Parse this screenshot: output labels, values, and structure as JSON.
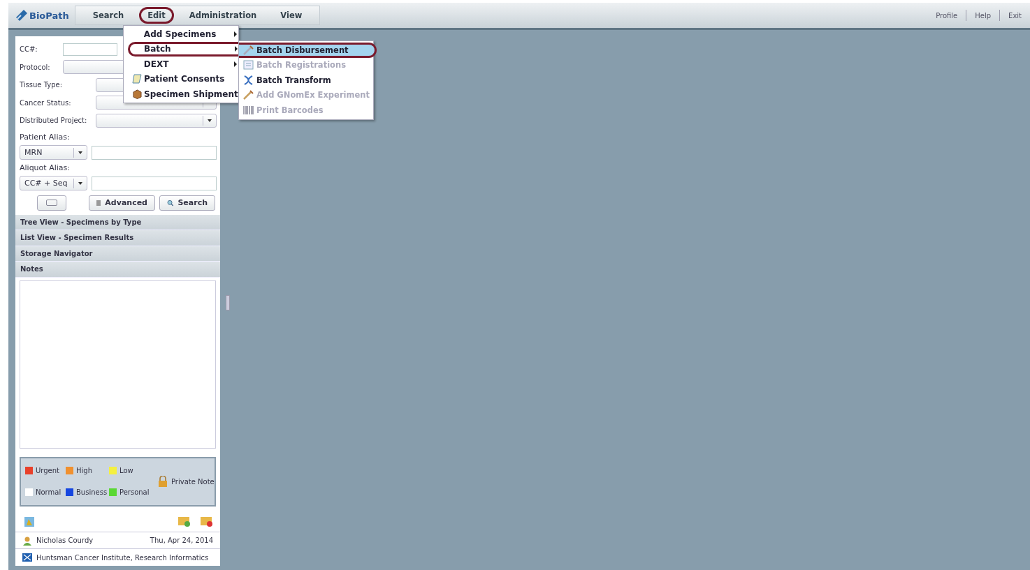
{
  "app": {
    "logo": "BioPath"
  },
  "menubar": [
    {
      "label": "Search",
      "circled": false
    },
    {
      "label": "Edit",
      "circled": true
    },
    {
      "label": "Administration",
      "circled": false
    },
    {
      "label": "View",
      "circled": false
    }
  ],
  "top_links": [
    "Profile",
    "Help",
    "Exit"
  ],
  "edit_menu": [
    {
      "label": "Add Specimens",
      "submenu": true,
      "circled": false
    },
    {
      "label": "Batch",
      "submenu": true,
      "circled": true
    },
    {
      "label": "DEXT",
      "submenu": true,
      "circled": false
    },
    {
      "label": "Patient Consents",
      "submenu": false,
      "circled": false
    },
    {
      "label": "Specimen Shipment",
      "submenu": false,
      "circled": false
    }
  ],
  "batch_menu": [
    {
      "label": "Batch Disbursement",
      "disabled": false,
      "selected": true
    },
    {
      "label": "Batch Registrations",
      "disabled": true,
      "selected": false
    },
    {
      "label": "Batch Transform",
      "disabled": false,
      "selected": false
    },
    {
      "label": "Add GNomEx Experiment",
      "disabled": true,
      "selected": false
    },
    {
      "label": "Print Barcodes",
      "disabled": true,
      "selected": false
    }
  ],
  "form": {
    "cc_label": "CC#:",
    "protocol_label": "Protocol:",
    "tissue_label": "Tissue Type:",
    "cancer_label": "Cancer Status:",
    "project_label": "Distributed Project:",
    "patient_alias_label": "Patient Alias:",
    "patient_alias_type": "MRN",
    "aliquot_alias_label": "Aliquot Alias:",
    "aliquot_alias_type": "CC# + Seq",
    "advanced_button": "Advanced",
    "search_button": "Search"
  },
  "sections": [
    "Tree View - Specimens by Type",
    "List View - Specimen Results",
    "Storage Navigator",
    "Notes"
  ],
  "legend": [
    {
      "label": "Urgent",
      "color": "#e8402a"
    },
    {
      "label": "High",
      "color": "#f0902e"
    },
    {
      "label": "Low",
      "color": "#f4f040"
    },
    {
      "label": "Normal",
      "color": "#ffffff"
    },
    {
      "label": "Business",
      "color": "#1646e0"
    },
    {
      "label": "Personal",
      "color": "#5ad834"
    }
  ],
  "private_note": "Private Note",
  "user": {
    "name": "Nicholas Courdy",
    "date": "Thu, Apr 24, 2014",
    "org": "Huntsman Cancer Institute, Research Informatics"
  }
}
